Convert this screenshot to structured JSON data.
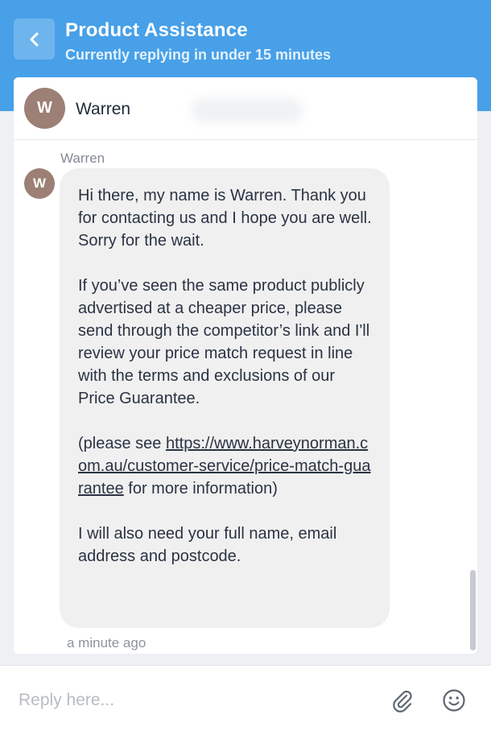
{
  "header": {
    "title": "Product Assistance",
    "subtitle": "Currently replying in under 15 minutes",
    "back_icon": "chevron-left-icon"
  },
  "agent": {
    "name": "Warren",
    "initial": "W"
  },
  "message": {
    "sender": "Warren",
    "avatar_initial": "W",
    "paragraph_1": "Hi there, my name is Warren. Thank you for contacting us and I hope you are well. Sorry for the wait.",
    "paragraph_2": "If you’ve seen the same product publicly advertised at a cheaper price, please send through the competitor’s link and I'll review your price match request in line with the terms and exclusions of our Price Guarantee.",
    "paragraph_3_prefix": "(please see ",
    "link_text": "https://www.harveynorman.com.au/customer-service/price-match-guarantee",
    "paragraph_3_suffix": " for more information)",
    "paragraph_4": "I will also need your full name, email address and postcode.",
    "timestamp": "a minute ago"
  },
  "composer": {
    "placeholder": "Reply here...",
    "attach_icon": "paperclip-icon",
    "emoji_icon": "smiley-icon"
  },
  "colors": {
    "header_bg": "#47a0e8",
    "avatar_bg": "#9c7f75",
    "bubble_bg": "#f0f0f0"
  }
}
